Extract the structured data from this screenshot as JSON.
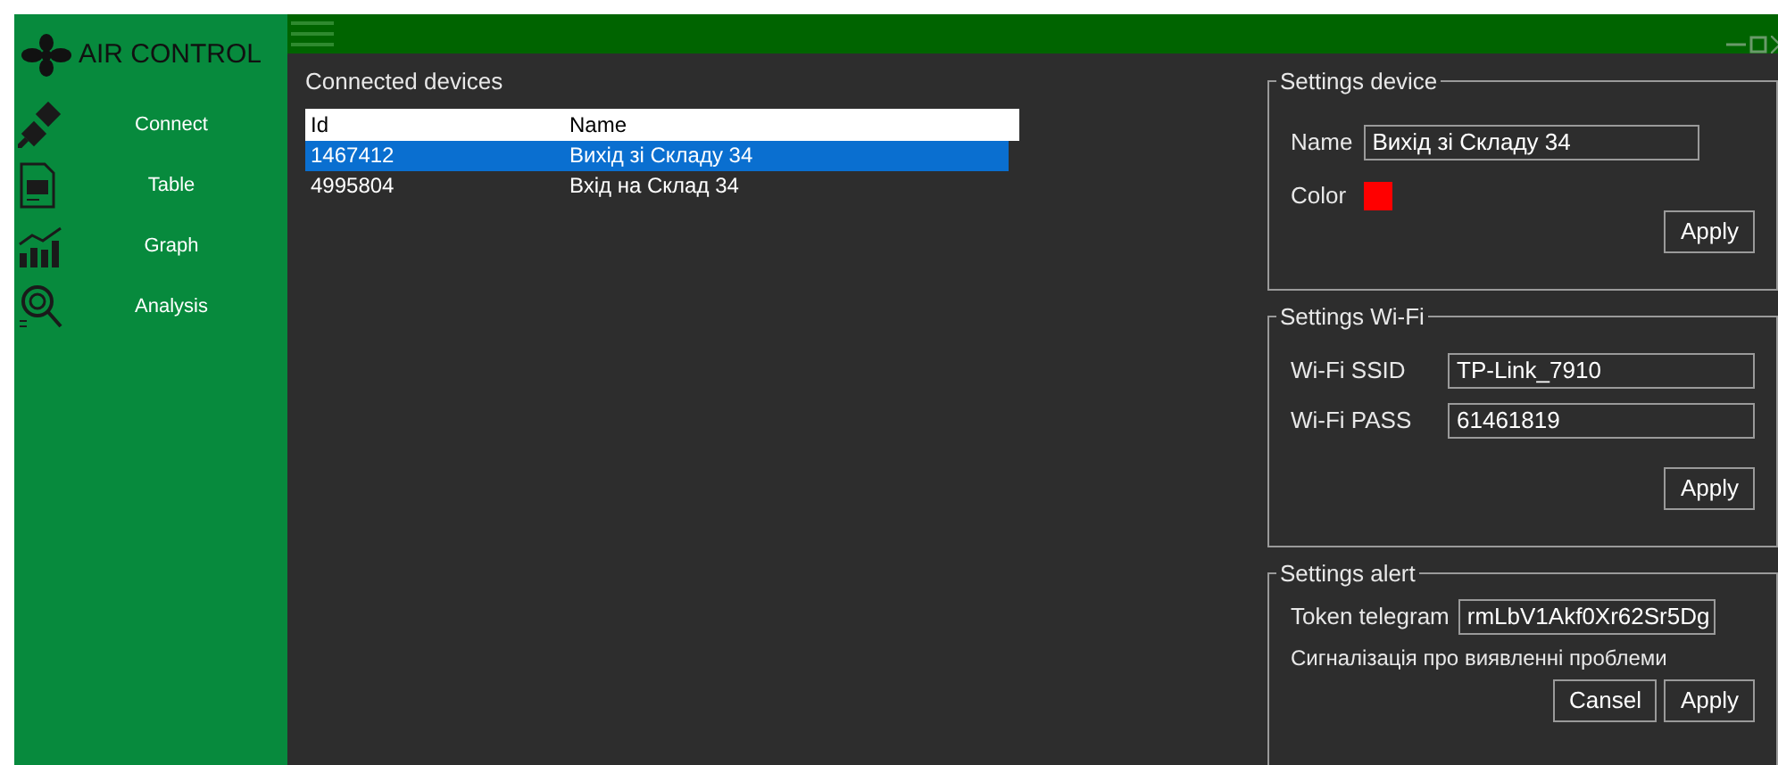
{
  "app": {
    "title": "AIR CONTROL"
  },
  "sidebar": {
    "items": [
      {
        "label": "Connect"
      },
      {
        "label": "Table"
      },
      {
        "label": "Graph"
      },
      {
        "label": "Analysis"
      }
    ]
  },
  "devices": {
    "title": "Connected devices",
    "columns": [
      "Id",
      "Name"
    ],
    "rows": [
      {
        "cells": [
          "1467412",
          "Вихід зі Складу 34"
        ],
        "selected": true
      },
      {
        "cells": [
          "4995804",
          "Вхід на Склад 34"
        ],
        "selected": false
      }
    ]
  },
  "settings_device": {
    "title": "Settings device",
    "name_label": "Name",
    "name_value": "Вихід зі Складу 34",
    "color_label": "Color",
    "color": "#ff0000",
    "button": "Apply"
  },
  "settings_wifi": {
    "title": "Settings Wi-Fi",
    "ssid_label": "Wi-Fi SSID",
    "ssid_value": "TP-Link_7910",
    "pass_label": "Wi-Fi PASS",
    "pass_value": "61461819",
    "button": "Apply"
  },
  "settings_alert": {
    "title": "Settings alert",
    "token_label": "Token telegram",
    "token_value": "rmLbV1Akf0Xr62Sr5Dg",
    "message": "Сигналізація про виявленні проблеми",
    "buttons": [
      "Cansel",
      "Apply"
    ]
  }
}
